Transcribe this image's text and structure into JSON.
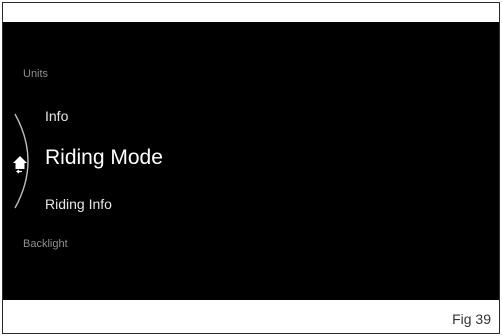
{
  "menu": {
    "items": [
      {
        "label": "Units"
      },
      {
        "label": "Info"
      },
      {
        "label": "Riding Mode"
      },
      {
        "label": "Riding Info"
      },
      {
        "label": "Backlight"
      }
    ],
    "selected_index": 2,
    "home_icon": "home-back-icon"
  },
  "figure": {
    "caption": "Fig 39"
  },
  "colors": {
    "screen_bg": "#000000",
    "selected_text": "#ffffff",
    "secondary_text": "#e6e6e6",
    "dim_text": "#8f8f8f",
    "arc": "#bdbdbd"
  }
}
